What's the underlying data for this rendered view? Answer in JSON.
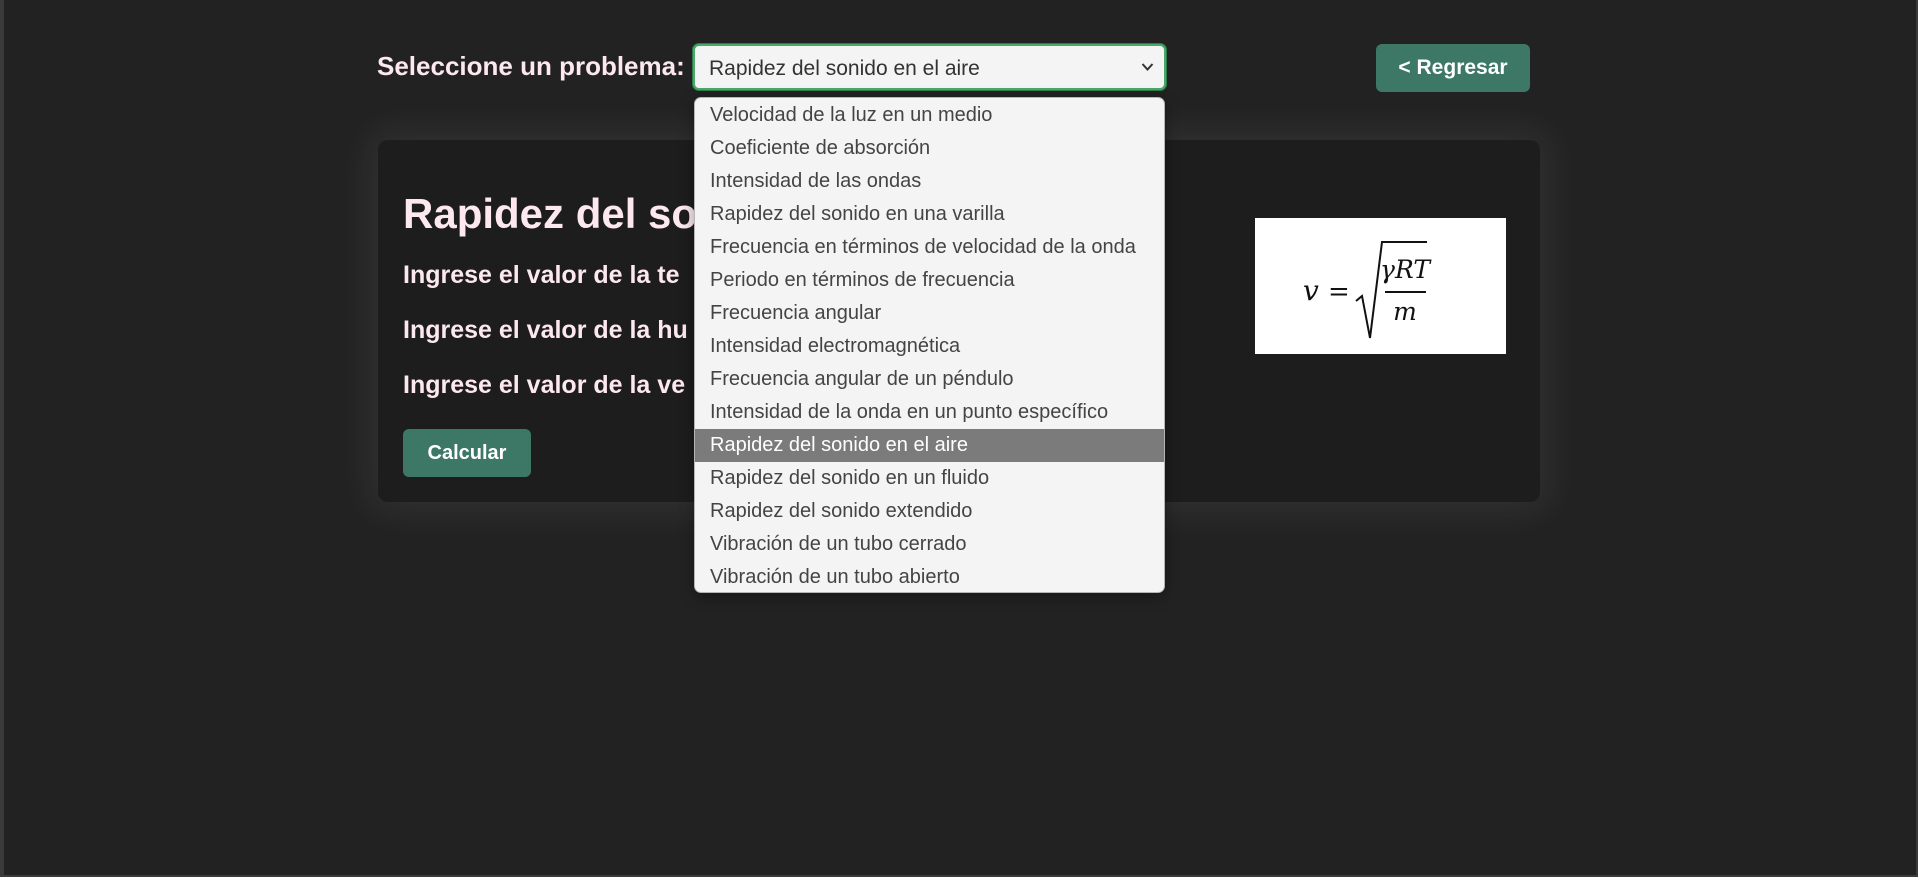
{
  "header": {
    "select_label": "Seleccione un problema:",
    "selected_problem": "Rapidez del sonido en el aire",
    "back_button": "< Regresar"
  },
  "dropdown": {
    "options": [
      "Velocidad de la luz en un medio",
      "Coeficiente de absorción",
      "Intensidad de las ondas",
      "Rapidez del sonido en una varilla",
      "Frecuencia en términos de velocidad de la onda",
      "Periodo en términos de frecuencia",
      "Frecuencia angular",
      "Intensidad electromagnética",
      "Frecuencia angular de un péndulo",
      "Intensidad de la onda en un punto específico",
      "Rapidez del sonido en el aire",
      "Rapidez del sonido en un fluido",
      "Rapidez del sonido extendido",
      "Vibración de un tubo cerrado",
      "Vibración de un tubo abierto"
    ],
    "selected_index": 10
  },
  "card": {
    "title": "Rapidez del sor",
    "prompts": [
      "Ingrese el valor de la te",
      "Ingrese el valor de la hu",
      "Ingrese el valor de la ve"
    ],
    "calculate_button": "Calcular"
  },
  "formula": {
    "lhs": "v",
    "equals": "=",
    "numerator": "γRT",
    "denominator": "m"
  },
  "colors": {
    "background": "#222222",
    "card": "#1d1d1d",
    "button": "#3d7766",
    "heading_text": "#fde8f0",
    "select_focus_border": "#4aa86a",
    "dropdown_bg": "#f4f4f4",
    "dropdown_selected": "#7b7b7b"
  },
  "icons": {
    "select_arrow": "chevron-down-icon"
  }
}
